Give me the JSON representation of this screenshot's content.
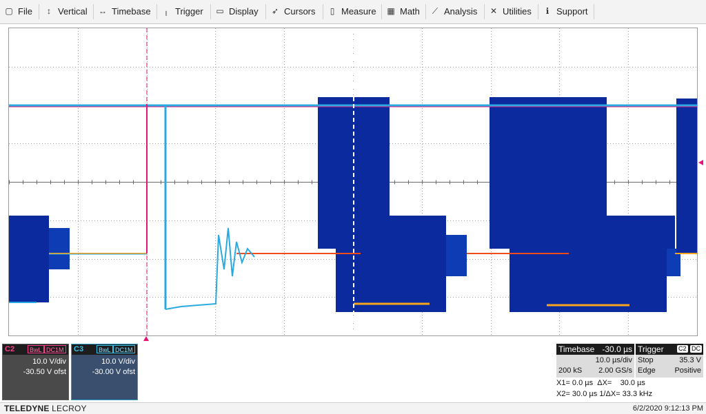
{
  "menu": {
    "file": "File",
    "vertical": "Vertical",
    "timebase": "Timebase",
    "trigger": "Trigger",
    "display": "Display",
    "cursors": "Cursors",
    "measure": "Measure",
    "math": "Math",
    "analysis": "Analysis",
    "utilities": "Utilities",
    "support": "Support"
  },
  "icons": {
    "vertical": "vertical-arrows-icon",
    "timebase": "horizontal-arrows-icon",
    "trigger": "trigger-icon",
    "display": "display-icon",
    "cursors": "cursors-icon",
    "measure": "measure-icon",
    "math": "math-icon",
    "analysis": "analysis-icon",
    "utilities": "utilities-icon",
    "support": "support-icon"
  },
  "colors": {
    "ch2": "#e3147a",
    "ch3": "#36c3f0",
    "persistence": "#0b2a9e"
  },
  "channels": [
    {
      "name": "C2",
      "bw": "BwL",
      "coupling": "DC1M",
      "vdiv": "10.0 V/div",
      "offset": "-30.50 V ofst"
    },
    {
      "name": "C3",
      "bw": "BwL",
      "coupling": "DC1M",
      "vdiv": "10.0 V/div",
      "offset": "-30.00 V ofst"
    }
  ],
  "timebase": {
    "label": "Timebase",
    "delay": "-30.0 µs",
    "tdiv": "10.0 µs/div",
    "samples": "200 kS",
    "rate": "2.00 GS/s"
  },
  "trigger": {
    "label": "Trigger",
    "source": "C2",
    "coupling": "DC",
    "mode": "Stop",
    "level": "35.3 V",
    "type": "Edge",
    "slope": "Positive"
  },
  "cursors": {
    "x1": "X1= 0.0 µs",
    "dx_label": "ΔX=",
    "dx": "30.0 µs",
    "x2": "X2= 30.0 µs",
    "inv_label": "1/ΔX=",
    "inv": "33.3 kHz"
  },
  "footer": {
    "brand_bold": "TELEDYNE",
    "brand_rest": "LECROY",
    "datetime": "6/2/2020 9:12:13 PM"
  }
}
